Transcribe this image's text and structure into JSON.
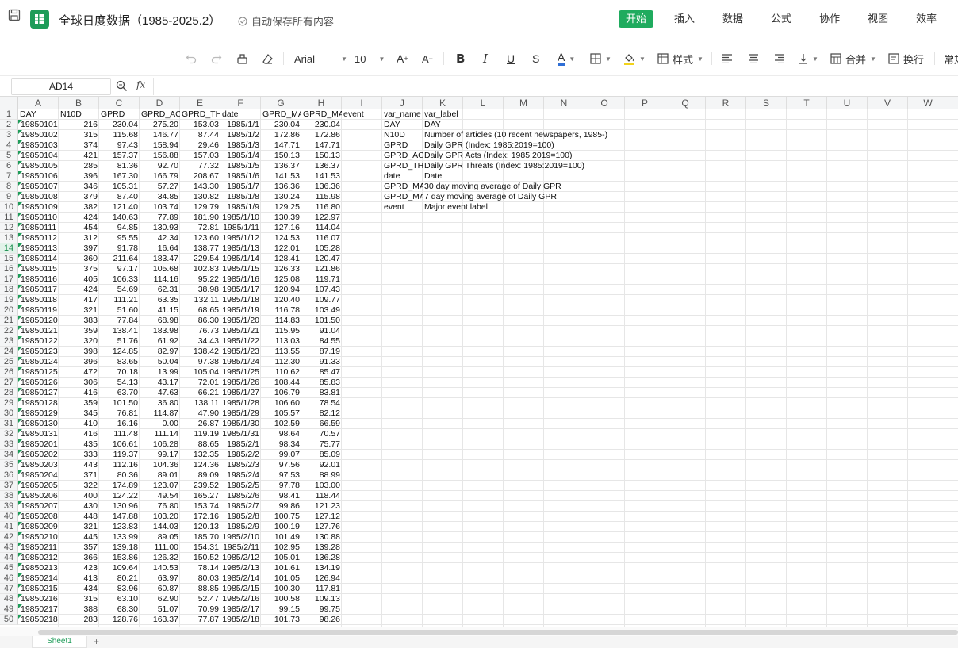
{
  "app": {
    "doc_title": "全球日度数据（1985-2025.2）",
    "autosave": "自动保存所有内容",
    "colors": {
      "brand": "#1e9c59",
      "accent": "#1fab5e"
    }
  },
  "menu": [
    "开始",
    "插入",
    "数据",
    "公式",
    "协作",
    "视图",
    "效率"
  ],
  "toolbar": {
    "font_name": "Arial",
    "font_size": "10",
    "style_label": "样式",
    "merge_label": "合并",
    "wrap_label": "换行",
    "number_format": "常规"
  },
  "formula_bar": {
    "name_box": "AD14",
    "formula": ""
  },
  "grid": {
    "columns": [
      "A",
      "B",
      "C",
      "D",
      "E",
      "F",
      "G",
      "H",
      "I",
      "J",
      "K",
      "L",
      "M",
      "N",
      "O",
      "P",
      "Q",
      "R",
      "S",
      "T",
      "U",
      "V",
      "W"
    ],
    "headers": [
      "DAY",
      "N10D",
      "GPRD",
      "GPRD_AC",
      "GPRD_TH",
      "date",
      "GPRD_MA",
      "GPRD_MA",
      "event"
    ],
    "rows": [
      [
        "19850101",
        "216",
        "230.04",
        "275.20",
        "153.03",
        "1985/1/1",
        "230.04",
        "230.04"
      ],
      [
        "19850102",
        "315",
        "115.68",
        "146.77",
        "87.44",
        "1985/1/2",
        "172.86",
        "172.86"
      ],
      [
        "19850103",
        "374",
        "97.43",
        "158.94",
        "29.46",
        "1985/1/3",
        "147.71",
        "147.71"
      ],
      [
        "19850104",
        "421",
        "157.37",
        "156.88",
        "157.03",
        "1985/1/4",
        "150.13",
        "150.13"
      ],
      [
        "19850105",
        "285",
        "81.36",
        "92.70",
        "77.32",
        "1985/1/5",
        "136.37",
        "136.37"
      ],
      [
        "19850106",
        "396",
        "167.30",
        "166.79",
        "208.67",
        "1985/1/6",
        "141.53",
        "141.53"
      ],
      [
        "19850107",
        "346",
        "105.31",
        "57.27",
        "143.30",
        "1985/1/7",
        "136.36",
        "136.36"
      ],
      [
        "19850108",
        "379",
        "87.40",
        "34.85",
        "130.82",
        "1985/1/8",
        "130.24",
        "115.98"
      ],
      [
        "19850109",
        "382",
        "121.40",
        "103.74",
        "129.79",
        "1985/1/9",
        "129.25",
        "116.80"
      ],
      [
        "19850110",
        "424",
        "140.63",
        "77.89",
        "181.90",
        "1985/1/10",
        "130.39",
        "122.97"
      ],
      [
        "19850111",
        "454",
        "94.85",
        "130.93",
        "72.81",
        "1985/1/11",
        "127.16",
        "114.04"
      ],
      [
        "19850112",
        "312",
        "95.55",
        "42.34",
        "123.60",
        "1985/1/12",
        "124.53",
        "116.07"
      ],
      [
        "19850113",
        "397",
        "91.78",
        "16.64",
        "138.77",
        "1985/1/13",
        "122.01",
        "105.28"
      ],
      [
        "19850114",
        "360",
        "211.64",
        "183.47",
        "229.54",
        "1985/1/14",
        "128.41",
        "120.47"
      ],
      [
        "19850115",
        "375",
        "97.17",
        "105.68",
        "102.83",
        "1985/1/15",
        "126.33",
        "121.86"
      ],
      [
        "19850116",
        "405",
        "106.33",
        "114.16",
        "95.22",
        "1985/1/16",
        "125.08",
        "119.71"
      ],
      [
        "19850117",
        "424",
        "54.69",
        "62.31",
        "38.98",
        "1985/1/17",
        "120.94",
        "107.43"
      ],
      [
        "19850118",
        "417",
        "111.21",
        "63.35",
        "132.11",
        "1985/1/18",
        "120.40",
        "109.77"
      ],
      [
        "19850119",
        "321",
        "51.60",
        "41.15",
        "68.65",
        "1985/1/19",
        "116.78",
        "103.49"
      ],
      [
        "19850120",
        "383",
        "77.84",
        "68.98",
        "86.30",
        "1985/1/20",
        "114.83",
        "101.50"
      ],
      [
        "19850121",
        "359",
        "138.41",
        "183.98",
        "76.73",
        "1985/1/21",
        "115.95",
        "91.04"
      ],
      [
        "19850122",
        "320",
        "51.76",
        "61.92",
        "34.43",
        "1985/1/22",
        "113.03",
        "84.55"
      ],
      [
        "19850123",
        "398",
        "124.85",
        "82.97",
        "138.42",
        "1985/1/23",
        "113.55",
        "87.19"
      ],
      [
        "19850124",
        "396",
        "83.65",
        "50.04",
        "97.38",
        "1985/1/24",
        "112.30",
        "91.33"
      ],
      [
        "19850125",
        "472",
        "70.18",
        "13.99",
        "105.04",
        "1985/1/25",
        "110.62",
        "85.47"
      ],
      [
        "19850126",
        "306",
        "54.13",
        "43.17",
        "72.01",
        "1985/1/26",
        "108.44",
        "85.83"
      ],
      [
        "19850127",
        "416",
        "63.70",
        "47.63",
        "66.21",
        "1985/1/27",
        "106.79",
        "83.81"
      ],
      [
        "19850128",
        "359",
        "101.50",
        "36.80",
        "138.11",
        "1985/1/28",
        "106.60",
        "78.54"
      ],
      [
        "19850129",
        "345",
        "76.81",
        "114.87",
        "47.90",
        "1985/1/29",
        "105.57",
        "82.12"
      ],
      [
        "19850130",
        "410",
        "16.16",
        "0.00",
        "26.87",
        "1985/1/30",
        "102.59",
        "66.59"
      ],
      [
        "19850131",
        "416",
        "111.48",
        "111.14",
        "119.19",
        "1985/1/31",
        "98.64",
        "70.57"
      ],
      [
        "19850201",
        "435",
        "106.61",
        "106.28",
        "88.65",
        "1985/2/1",
        "98.34",
        "75.77"
      ],
      [
        "19850202",
        "333",
        "119.37",
        "99.17",
        "132.35",
        "1985/2/2",
        "99.07",
        "85.09"
      ],
      [
        "19850203",
        "443",
        "112.16",
        "104.36",
        "124.36",
        "1985/2/3",
        "97.56",
        "92.01"
      ],
      [
        "19850204",
        "371",
        "80.36",
        "89.01",
        "89.09",
        "1985/2/4",
        "97.53",
        "88.99"
      ],
      [
        "19850205",
        "322",
        "174.89",
        "123.07",
        "239.52",
        "1985/2/5",
        "97.78",
        "103.00"
      ],
      [
        "19850206",
        "400",
        "124.22",
        "49.54",
        "165.27",
        "1985/2/6",
        "98.41",
        "118.44"
      ],
      [
        "19850207",
        "430",
        "130.96",
        "76.80",
        "153.74",
        "1985/2/7",
        "99.86",
        "121.23"
      ],
      [
        "19850208",
        "448",
        "147.88",
        "103.20",
        "172.16",
        "1985/2/8",
        "100.75",
        "127.12"
      ],
      [
        "19850209",
        "321",
        "123.83",
        "144.03",
        "120.13",
        "1985/2/9",
        "100.19",
        "127.76"
      ],
      [
        "19850210",
        "445",
        "133.99",
        "89.05",
        "185.70",
        "1985/2/10",
        "101.49",
        "130.88"
      ],
      [
        "19850211",
        "357",
        "139.18",
        "111.00",
        "154.31",
        "1985/2/11",
        "102.95",
        "139.28"
      ],
      [
        "19850212",
        "366",
        "153.86",
        "126.32",
        "150.52",
        "1985/2/12",
        "105.01",
        "136.28"
      ],
      [
        "19850213",
        "423",
        "109.64",
        "140.53",
        "78.14",
        "1985/2/13",
        "101.61",
        "134.19"
      ],
      [
        "19850214",
        "413",
        "80.21",
        "63.97",
        "80.03",
        "1985/2/14",
        "101.05",
        "126.94"
      ],
      [
        "19850215",
        "434",
        "83.96",
        "60.87",
        "88.85",
        "1985/2/15",
        "100.30",
        "117.81"
      ],
      [
        "19850216",
        "315",
        "63.10",
        "62.90",
        "52.47",
        "1985/2/16",
        "100.58",
        "109.13"
      ],
      [
        "19850217",
        "388",
        "68.30",
        "51.07",
        "70.99",
        "1985/2/17",
        "99.15",
        "99.75"
      ],
      [
        "19850218",
        "283",
        "128.76",
        "163.37",
        "77.87",
        "1985/2/18",
        "101.73",
        "98.26"
      ]
    ],
    "var_table": [
      [
        "var_name",
        "var_label"
      ],
      [
        "DAY",
        "DAY"
      ],
      [
        "N10D",
        "Number of articles (10 recent newspapers, 1985-)"
      ],
      [
        "GPRD",
        "Daily GPR (Index: 1985:2019=100)"
      ],
      [
        "GPRD_AC",
        "Daily GPR Acts (Index: 1985:2019=100)"
      ],
      [
        "GPRD_TH",
        "Daily GPR Threats (Index: 1985:2019=100)"
      ],
      [
        "date",
        "Date"
      ],
      [
        "GPRD_MA",
        "30 day moving average of Daily GPR"
      ],
      [
        "GPRD_MA",
        "7 day moving average of Daily GPR"
      ],
      [
        "event",
        "Major event label"
      ]
    ],
    "selected_row": "14"
  },
  "sheets": {
    "active": "Sheet1",
    "add": "+"
  }
}
